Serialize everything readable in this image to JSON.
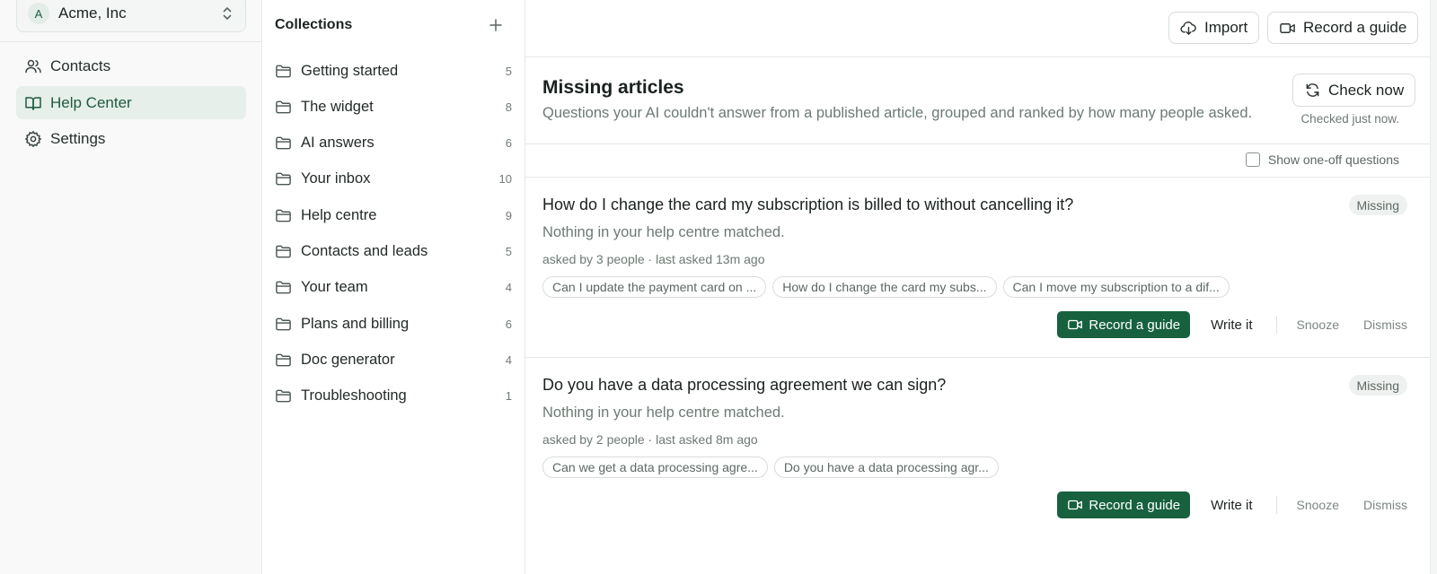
{
  "sidebar": {
    "workspace": {
      "initial": "A",
      "name": "Acme, Inc"
    },
    "items": [
      {
        "label": "Contacts",
        "icon": "users-icon"
      },
      {
        "label": "Help Center",
        "icon": "book-open-icon",
        "active": true
      },
      {
        "label": "Settings",
        "icon": "gear-icon"
      }
    ]
  },
  "collections": {
    "title": "Collections",
    "items": [
      {
        "name": "Getting started",
        "count": "5"
      },
      {
        "name": "The widget",
        "count": "8"
      },
      {
        "name": "AI answers",
        "count": "6"
      },
      {
        "name": "Your inbox",
        "count": "10"
      },
      {
        "name": "Help centre",
        "count": "9"
      },
      {
        "name": "Contacts and leads",
        "count": "5"
      },
      {
        "name": "Your team",
        "count": "4"
      },
      {
        "name": "Plans and billing",
        "count": "6"
      },
      {
        "name": "Doc generator",
        "count": "4"
      },
      {
        "name": "Troubleshooting",
        "count": "1"
      }
    ]
  },
  "topbar": {
    "import_label": "Import",
    "record_label": "Record a guide"
  },
  "section": {
    "title": "Missing articles",
    "subtitle": "Questions your AI couldn't answer from a published article, grouped and ranked by how many people asked.",
    "check_now_label": "Check now",
    "checked_note": "Checked just now.",
    "show_oneoff_label": "Show one-off questions"
  },
  "questions": [
    {
      "title": "How do I change the card my subscription is billed to without cancelling it?",
      "badge": "Missing",
      "note": "Nothing in your help centre matched.",
      "meta": "asked by 3 people · last asked 13m ago",
      "chips": [
        "Can I update the payment card on ...",
        "How do I change the card my subs...",
        "Can I move my subscription to a dif..."
      ],
      "record_label": "Record a guide",
      "write_label": "Write it",
      "snooze_label": "Snooze",
      "dismiss_label": "Dismiss"
    },
    {
      "title": "Do you have a data processing agreement we can sign?",
      "badge": "Missing",
      "note": "Nothing in your help centre matched.",
      "meta": "asked by 2 people · last asked 8m ago",
      "chips": [
        "Can we get a data processing agre...",
        "Do you have a data processing agr..."
      ],
      "record_label": "Record a guide",
      "write_label": "Write it",
      "snooze_label": "Snooze",
      "dismiss_label": "Dismiss"
    }
  ],
  "colors": {
    "accent": "#17613f",
    "active_nav_bg": "#e6efea",
    "sidebar_bg": "#f8f9f8"
  }
}
